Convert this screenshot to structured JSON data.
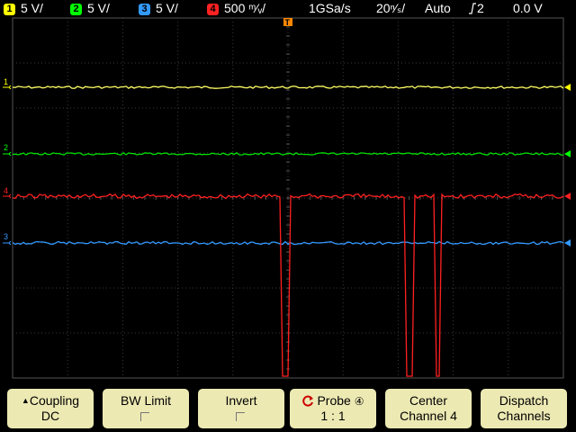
{
  "status_bar": {
    "ch1": {
      "num": "1",
      "scale": "5 V/",
      "color": "#ffff00"
    },
    "ch2": {
      "num": "2",
      "scale": "5 V/",
      "color": "#00ff00"
    },
    "ch3": {
      "num": "3",
      "scale": "5 V/",
      "color": "#3399ff"
    },
    "ch4": {
      "num": "4",
      "scale": "500 ᵐ⁄ᵥ/",
      "color": "#ff2222"
    },
    "sample_rate": "1GSa/s",
    "timebase": "20ⁿ⁄ₛ/",
    "trigger_mode": "Auto",
    "trigger_source_icon": "rising-edge-icon",
    "trigger_source": "2",
    "trigger_level": "0.0 V"
  },
  "markers": {
    "ch1": "1",
    "ch2": "2",
    "ch3": "3",
    "ch4": "4",
    "trigger_pos": "T"
  },
  "trace_colors": {
    "ch1": "#ffff66",
    "ch2": "#00e000",
    "ch3": "#3399ff",
    "ch4": "#ff2020"
  },
  "softkeys": [
    {
      "line1": "Coupling",
      "line2": "DC",
      "icon": "up-arrow-icon"
    },
    {
      "line1": "BW Limit",
      "line2": ""
    },
    {
      "line1": "Invert",
      "line2": ""
    },
    {
      "line1": "Probe",
      "line2": "1 : 1",
      "icon": "rotate-knob-icon",
      "suffix": "④"
    },
    {
      "line1": "Center",
      "line2": "Channel 4"
    },
    {
      "line1": "Dispatch",
      "line2": "Channels"
    }
  ]
}
